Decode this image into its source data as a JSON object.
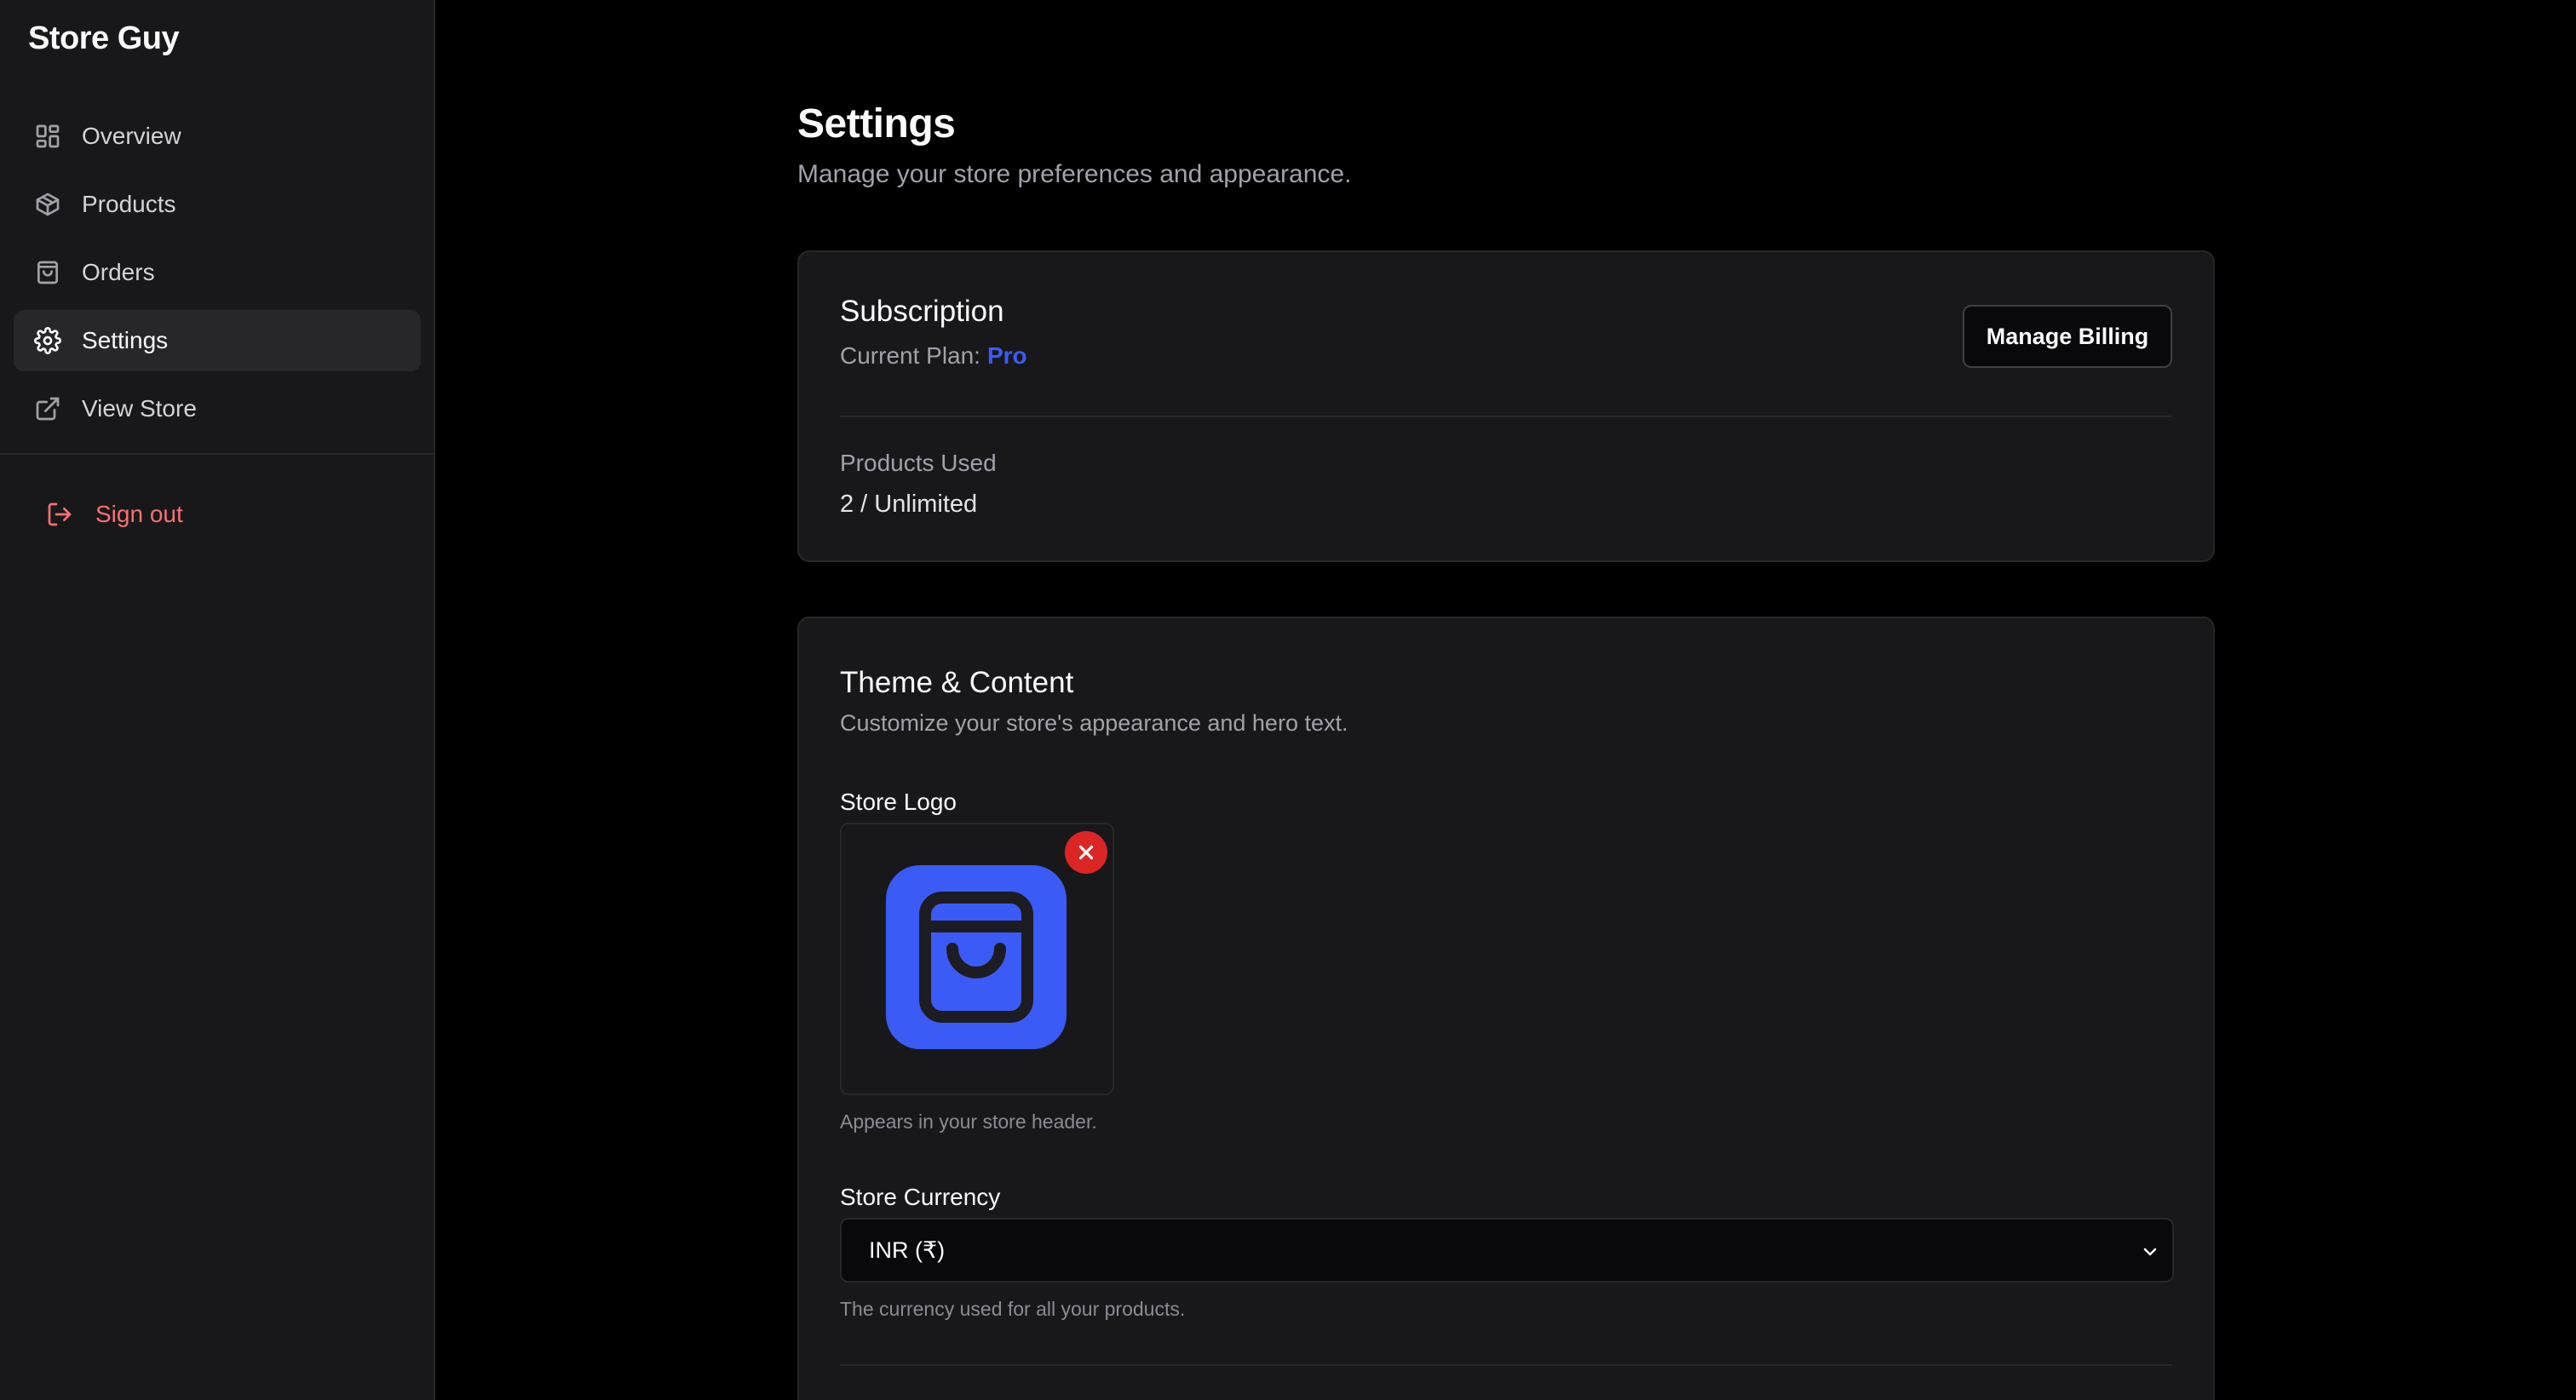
{
  "sidebar": {
    "brand": "Store Guy",
    "items": [
      {
        "label": "Overview",
        "icon": "layout-grid-icon",
        "active": false
      },
      {
        "label": "Products",
        "icon": "package-icon",
        "active": false
      },
      {
        "label": "Orders",
        "icon": "shopping-bag-icon",
        "active": false
      },
      {
        "label": "Settings",
        "icon": "gear-icon",
        "active": true
      },
      {
        "label": "View Store",
        "icon": "external-link-icon",
        "active": false
      }
    ],
    "signout": {
      "label": "Sign out",
      "icon": "log-out-icon"
    }
  },
  "page": {
    "title": "Settings",
    "subtitle": "Manage your store preferences and appearance."
  },
  "subscription": {
    "title": "Subscription",
    "plan_label": "Current Plan:",
    "plan_value": "Pro",
    "manage_billing_label": "Manage Billing",
    "usage_label": "Products Used",
    "usage_value": "2 / Unlimited"
  },
  "theme": {
    "title": "Theme & Content",
    "description": "Customize your store's appearance and hero text.",
    "logo": {
      "label": "Store Logo",
      "hint": "Appears in your store header."
    },
    "currency": {
      "label": "Store Currency",
      "selected": "INR (₹)",
      "hint": "The currency used for all your products."
    }
  },
  "colors": {
    "accent": "#3b5bf6",
    "danger": "#dc2626",
    "signout": "#f87171",
    "sidebar_bg": "#18181b",
    "page_bg": "#000000"
  }
}
